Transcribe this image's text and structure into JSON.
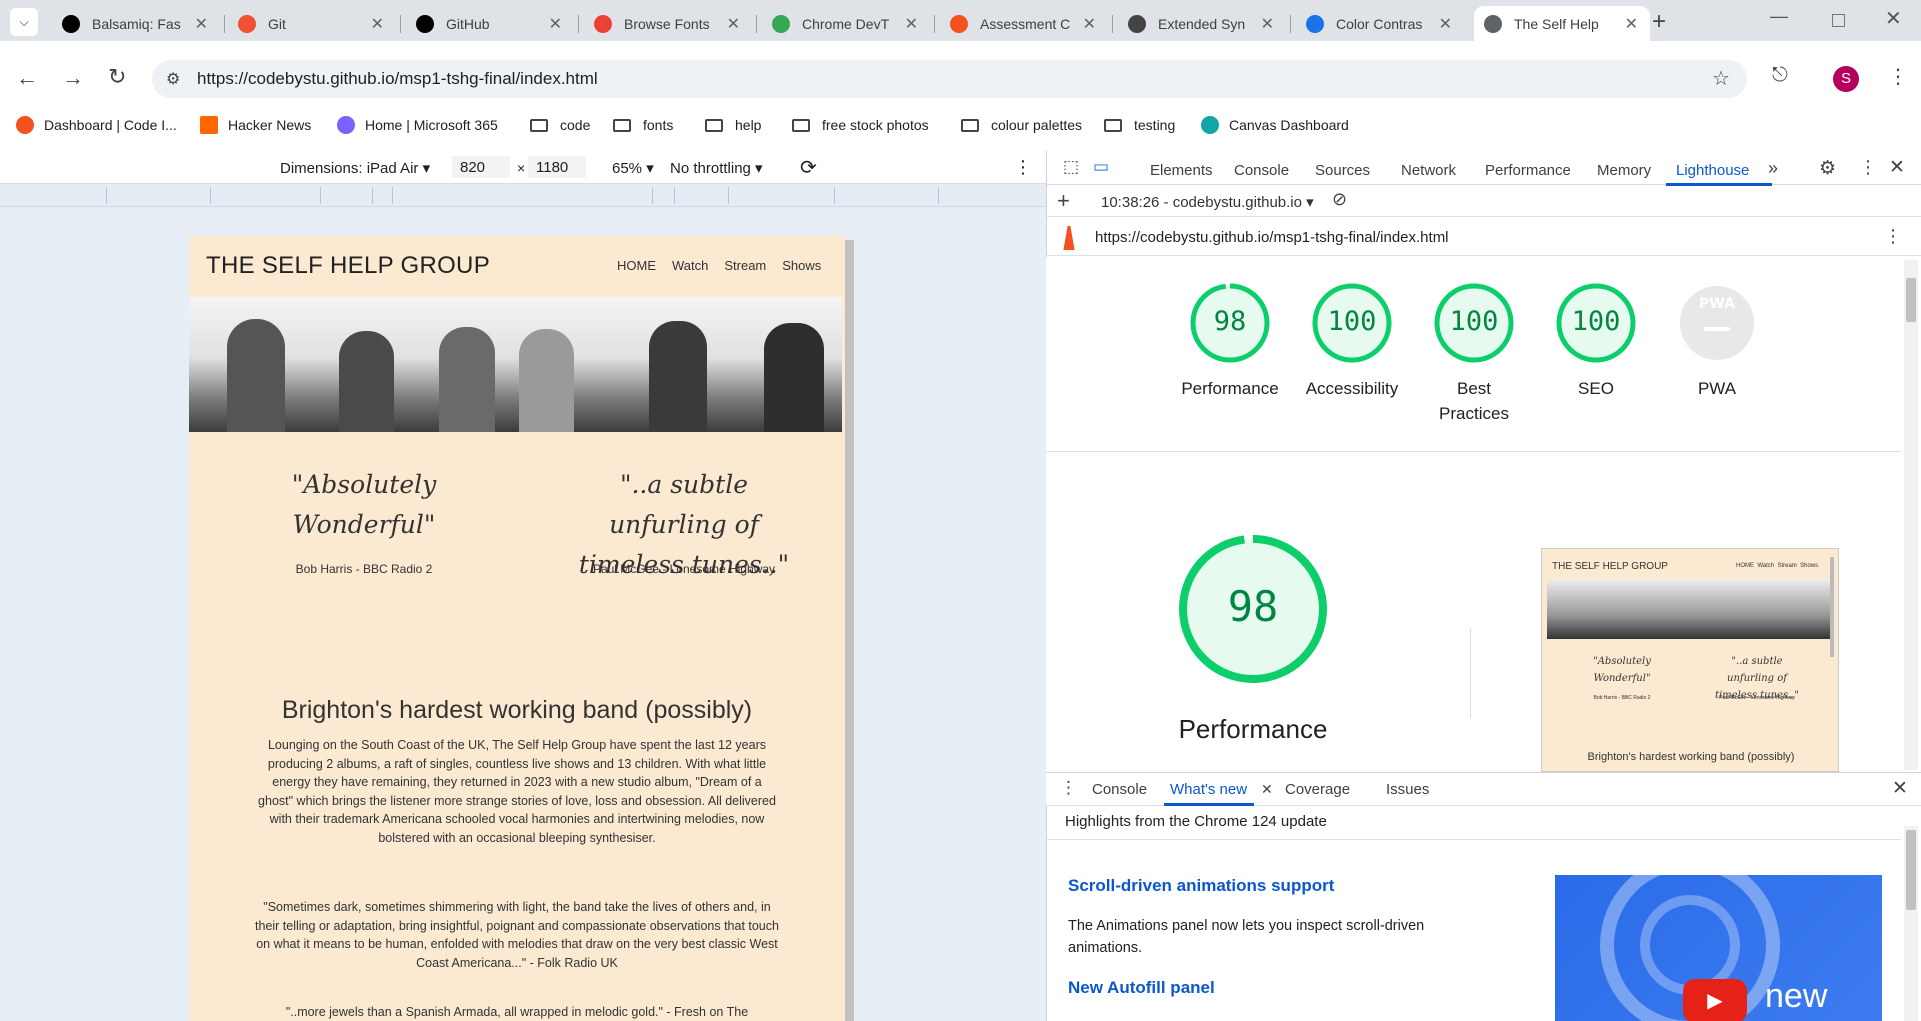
{
  "tabs": [
    {
      "title": "Balsamiq: Fas",
      "icon": "smiley-icon",
      "color": "#000"
    },
    {
      "title": "Git",
      "icon": "git-icon",
      "color": "#f05033"
    },
    {
      "title": "GitHub",
      "icon": "github-icon",
      "color": "#000"
    },
    {
      "title": "Browse Fonts",
      "icon": "google-fonts-icon",
      "color": "#e94235"
    },
    {
      "title": "Chrome DevT",
      "icon": "chrome-icon",
      "color": "#34a853"
    },
    {
      "title": "Assessment C",
      "icon": "ring-icon",
      "color": "#f4511e"
    },
    {
      "title": "Extended Syn",
      "icon": "markdown-icon",
      "color": "#444"
    },
    {
      "title": "Color Contras",
      "icon": "contrast-icon",
      "color": "#1a73e8"
    },
    {
      "title": "The Self Help",
      "icon": "globe-icon",
      "color": "#5f6368"
    }
  ],
  "url": "https://codebystu.github.io/msp1-tshg-final/index.html",
  "profile_initial": "S",
  "bookmarks": [
    {
      "label": "Dashboard | Code I...",
      "icon": "code-institute-icon"
    },
    {
      "label": "Hacker News",
      "icon": "hacker-news-icon"
    },
    {
      "label": "Home | Microsoft 365",
      "icon": "microsoft365-icon"
    },
    {
      "label": "code",
      "icon": "folder-icon"
    },
    {
      "label": "fonts",
      "icon": "folder-icon"
    },
    {
      "label": "help",
      "icon": "folder-icon"
    },
    {
      "label": "free stock photos",
      "icon": "folder-icon"
    },
    {
      "label": "colour palettes",
      "icon": "folder-icon"
    },
    {
      "label": "testing",
      "icon": "folder-icon"
    },
    {
      "label": "Canvas Dashboard",
      "icon": "canvas-icon"
    }
  ],
  "device": {
    "label": "Dimensions: iPad Air",
    "width": "820",
    "height": "1180",
    "zoom": "65%",
    "throttle": "No throttling"
  },
  "site": {
    "title": "THE SELF HELP GROUP",
    "nav": [
      "HOME",
      "Watch",
      "Stream",
      "Shows"
    ],
    "quote1": "\"Absolutely Wonderful\"",
    "quote1_src": "Bob Harris - BBC Radio 2",
    "quote2": "\"..a subtle unfurling of timeless tunes..\"",
    "quote2_src": "Paul McGee - Lonesome Highway",
    "heading": "Brighton's hardest working band (possibly)",
    "para1": "Lounging on the South Coast of the UK, The Self Help Group have spent the last 12 years producing 2 albums, a raft of singles, countless live shows and 13 children. With what little energy they have remaining, they returned in 2023 with a new studio album, \"Dream of a ghost\" which brings the listener more strange stories of love, loss and obsession. All delivered with their trademark Americana schooled vocal harmonies and intertwining melodies, now bolstered with an occasional bleeping synthesiser.",
    "para2": "\"Sometimes dark, sometimes shimmering with light, the band take the lives of others and, in their telling or adaptation, bring insightful, poignant and compassionate observations that touch on what it means to be human, enfolded with melodies that draw on the very best classic West Coast Americana...\" - Folk Radio UK",
    "para3": "\"..more jewels than a Spanish Armada, all wrapped in melodic gold.\" - Fresh on The"
  },
  "devtools": {
    "tabs": [
      "Elements",
      "Console",
      "Sources",
      "Network",
      "Performance",
      "Memory",
      "Lighthouse"
    ],
    "active_tab": "Lighthouse",
    "report_time": "10:38:26 - codebystu.github.io",
    "report_url": "https://codebystu.github.io/msp1-tshg-final/index.html",
    "scores": [
      {
        "value": "98",
        "label": "Performance",
        "score": 0.98
      },
      {
        "value": "100",
        "label": "Accessibility",
        "score": 1.0
      },
      {
        "value": "100",
        "label": "Best Practices",
        "score": 1.0
      },
      {
        "value": "100",
        "label": "SEO",
        "score": 1.0
      },
      {
        "value": "PWA",
        "label": "PWA",
        "score": null
      }
    ],
    "big_score": "98",
    "big_label": "Performance",
    "thumb_title": "THE SELF HELP GROUP",
    "thumb_nav": "HOME  Watch  Stream  Shows",
    "thumb_q1": "\"Absolutely Wonderful\"",
    "thumb_q2": "\"..a subtle unfurling of timeless tunes..\"",
    "thumb_s1": "Bob Harris - BBC Radio 2",
    "thumb_s2": "Paul McGee - Lonesome Highway",
    "thumb_heading": "Brighton's hardest working band (possibly)",
    "drawer_tabs": [
      "Console",
      "What's new",
      "Coverage",
      "Issues"
    ],
    "drawer_active": "What's new",
    "highlights": "Highlights from the Chrome 124 update",
    "news1_title": "Scroll-driven animations support",
    "news1_body": "The Animations panel now lets you inspect scroll-driven animations.",
    "news2_title": "New Autofill panel",
    "video_label": "new"
  },
  "colors": {
    "accent": "#0b57d0",
    "lighthouse_green": "#0cce6b",
    "page_bg": "#fbe9d1"
  }
}
